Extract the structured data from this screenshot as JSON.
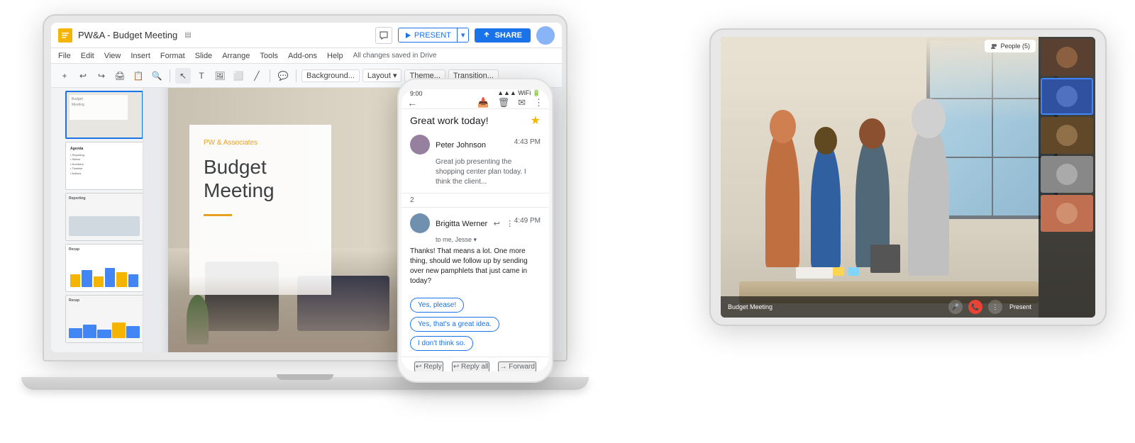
{
  "laptop": {
    "title": "PW&A - Budget Meeting",
    "logo_letter": "",
    "menu": {
      "items": [
        "File",
        "Edit",
        "View",
        "Insert",
        "Format",
        "Slide",
        "Arrange",
        "Tools",
        "Add-ons",
        "Help"
      ],
      "save_status": "All changes saved in Drive"
    },
    "toolbar": {
      "buttons": [
        "+",
        "↩",
        "↪",
        "🖨",
        "📋",
        "🔍",
        "↕"
      ],
      "dropdowns": [
        "Background...",
        "Layout ▾",
        "Theme...",
        "Transition..."
      ]
    },
    "header": {
      "present_label": "PRESENT",
      "share_label": "SHARE"
    },
    "slide": {
      "company": "PW & Associates",
      "heading": "Budget Meeting",
      "slide_count": 5
    }
  },
  "phone": {
    "time": "9:00",
    "email": {
      "subject": "Great work today!",
      "star": "★",
      "messages": [
        {
          "sender": "Peter Johnson",
          "time": "4:43 PM",
          "preview": "Great job presenting the shopping center plan today. I think the client..."
        },
        {
          "number": "2",
          "sender": "Brigitta Werner",
          "time": "4:49 PM",
          "to": "to me, Jesse ▾",
          "body": "Thanks! That means a lot. One more thing, should we follow up by sending over new pamphlets that just came in today?"
        }
      ],
      "smart_replies": [
        "Yes, please!",
        "Yes, that's a great idea.",
        "I don't think so."
      ],
      "footer_buttons": [
        "↩ Reply",
        "↩ Reply all",
        "→ Forward"
      ]
    }
  },
  "tablet": {
    "meeting_label": "Budget Meeting",
    "people_count": "People (5)",
    "present_label": "Present",
    "video_thumbs": [
      {
        "label": "thumb1",
        "bg": "#5a4030"
      },
      {
        "label": "thumb2",
        "bg": "#3050a0"
      },
      {
        "label": "thumb3",
        "bg": "#604828"
      },
      {
        "label": "thumb4",
        "bg": "#888888"
      },
      {
        "label": "thumb5",
        "bg": "#c07050"
      }
    ]
  },
  "icons": {
    "back_arrow": "←",
    "archive": "📥",
    "delete": "🗑",
    "email_outline": "✉",
    "more_vert": "⋮",
    "reply": "↩",
    "mic": "🎤",
    "end_call": "📞",
    "more": "⋮",
    "camera": "📷",
    "people": "👥",
    "chat": "💬"
  }
}
